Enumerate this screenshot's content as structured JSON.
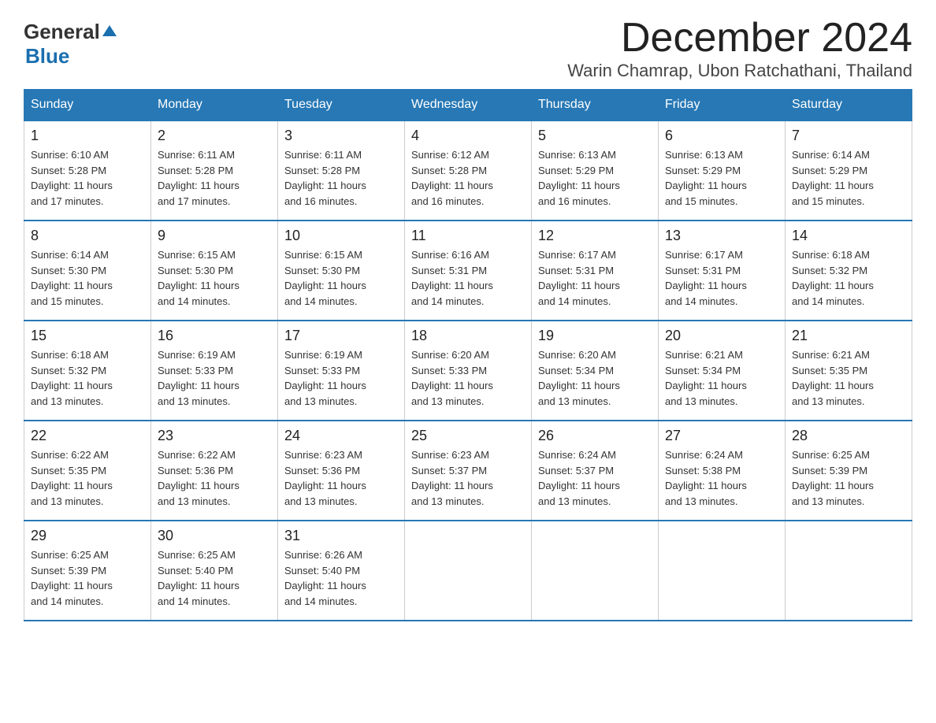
{
  "header": {
    "logo": {
      "general": "General",
      "blue": "Blue",
      "arrow": "▼"
    },
    "title": "December 2024",
    "subtitle": "Warin Chamrap, Ubon Ratchathani, Thailand"
  },
  "days_of_week": [
    "Sunday",
    "Monday",
    "Tuesday",
    "Wednesday",
    "Thursday",
    "Friday",
    "Saturday"
  ],
  "weeks": [
    [
      {
        "day": "1",
        "sunrise": "6:10 AM",
        "sunset": "5:28 PM",
        "daylight": "11 hours and 17 minutes."
      },
      {
        "day": "2",
        "sunrise": "6:11 AM",
        "sunset": "5:28 PM",
        "daylight": "11 hours and 17 minutes."
      },
      {
        "day": "3",
        "sunrise": "6:11 AM",
        "sunset": "5:28 PM",
        "daylight": "11 hours and 16 minutes."
      },
      {
        "day": "4",
        "sunrise": "6:12 AM",
        "sunset": "5:28 PM",
        "daylight": "11 hours and 16 minutes."
      },
      {
        "day": "5",
        "sunrise": "6:13 AM",
        "sunset": "5:29 PM",
        "daylight": "11 hours and 16 minutes."
      },
      {
        "day": "6",
        "sunrise": "6:13 AM",
        "sunset": "5:29 PM",
        "daylight": "11 hours and 15 minutes."
      },
      {
        "day": "7",
        "sunrise": "6:14 AM",
        "sunset": "5:29 PM",
        "daylight": "11 hours and 15 minutes."
      }
    ],
    [
      {
        "day": "8",
        "sunrise": "6:14 AM",
        "sunset": "5:30 PM",
        "daylight": "11 hours and 15 minutes."
      },
      {
        "day": "9",
        "sunrise": "6:15 AM",
        "sunset": "5:30 PM",
        "daylight": "11 hours and 14 minutes."
      },
      {
        "day": "10",
        "sunrise": "6:15 AM",
        "sunset": "5:30 PM",
        "daylight": "11 hours and 14 minutes."
      },
      {
        "day": "11",
        "sunrise": "6:16 AM",
        "sunset": "5:31 PM",
        "daylight": "11 hours and 14 minutes."
      },
      {
        "day": "12",
        "sunrise": "6:17 AM",
        "sunset": "5:31 PM",
        "daylight": "11 hours and 14 minutes."
      },
      {
        "day": "13",
        "sunrise": "6:17 AM",
        "sunset": "5:31 PM",
        "daylight": "11 hours and 14 minutes."
      },
      {
        "day": "14",
        "sunrise": "6:18 AM",
        "sunset": "5:32 PM",
        "daylight": "11 hours and 14 minutes."
      }
    ],
    [
      {
        "day": "15",
        "sunrise": "6:18 AM",
        "sunset": "5:32 PM",
        "daylight": "11 hours and 13 minutes."
      },
      {
        "day": "16",
        "sunrise": "6:19 AM",
        "sunset": "5:33 PM",
        "daylight": "11 hours and 13 minutes."
      },
      {
        "day": "17",
        "sunrise": "6:19 AM",
        "sunset": "5:33 PM",
        "daylight": "11 hours and 13 minutes."
      },
      {
        "day": "18",
        "sunrise": "6:20 AM",
        "sunset": "5:33 PM",
        "daylight": "11 hours and 13 minutes."
      },
      {
        "day": "19",
        "sunrise": "6:20 AM",
        "sunset": "5:34 PM",
        "daylight": "11 hours and 13 minutes."
      },
      {
        "day": "20",
        "sunrise": "6:21 AM",
        "sunset": "5:34 PM",
        "daylight": "11 hours and 13 minutes."
      },
      {
        "day": "21",
        "sunrise": "6:21 AM",
        "sunset": "5:35 PM",
        "daylight": "11 hours and 13 minutes."
      }
    ],
    [
      {
        "day": "22",
        "sunrise": "6:22 AM",
        "sunset": "5:35 PM",
        "daylight": "11 hours and 13 minutes."
      },
      {
        "day": "23",
        "sunrise": "6:22 AM",
        "sunset": "5:36 PM",
        "daylight": "11 hours and 13 minutes."
      },
      {
        "day": "24",
        "sunrise": "6:23 AM",
        "sunset": "5:36 PM",
        "daylight": "11 hours and 13 minutes."
      },
      {
        "day": "25",
        "sunrise": "6:23 AM",
        "sunset": "5:37 PM",
        "daylight": "11 hours and 13 minutes."
      },
      {
        "day": "26",
        "sunrise": "6:24 AM",
        "sunset": "5:37 PM",
        "daylight": "11 hours and 13 minutes."
      },
      {
        "day": "27",
        "sunrise": "6:24 AM",
        "sunset": "5:38 PM",
        "daylight": "11 hours and 13 minutes."
      },
      {
        "day": "28",
        "sunrise": "6:25 AM",
        "sunset": "5:39 PM",
        "daylight": "11 hours and 13 minutes."
      }
    ],
    [
      {
        "day": "29",
        "sunrise": "6:25 AM",
        "sunset": "5:39 PM",
        "daylight": "11 hours and 14 minutes."
      },
      {
        "day": "30",
        "sunrise": "6:25 AM",
        "sunset": "5:40 PM",
        "daylight": "11 hours and 14 minutes."
      },
      {
        "day": "31",
        "sunrise": "6:26 AM",
        "sunset": "5:40 PM",
        "daylight": "11 hours and 14 minutes."
      },
      null,
      null,
      null,
      null
    ]
  ],
  "labels": {
    "sunrise": "Sunrise:",
    "sunset": "Sunset:",
    "daylight": "Daylight:"
  }
}
